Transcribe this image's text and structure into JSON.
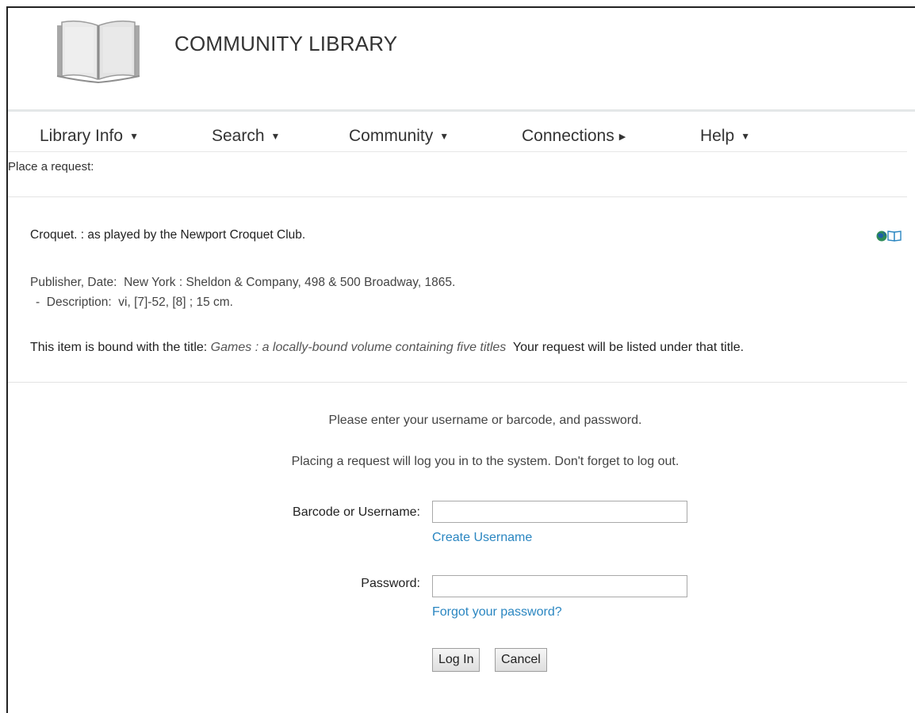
{
  "header": {
    "brand": "COMMUNITY LIBRARY",
    "logo_icon": "open-book-icon"
  },
  "nav": {
    "items": [
      {
        "label": "Library Info",
        "indicator": "caret-down"
      },
      {
        "label": "Search",
        "indicator": "caret-down"
      },
      {
        "label": "Community",
        "indicator": "caret-down"
      },
      {
        "label": "Connections",
        "indicator": "caret-right"
      },
      {
        "label": "Help",
        "indicator": "caret-down"
      }
    ]
  },
  "page": {
    "heading": "Place a request:"
  },
  "item": {
    "title": "Croquet. : as played by the Newport Croquet Club.",
    "icons": [
      "globe-icon",
      "book-icon"
    ],
    "publisher_label": "Publisher, Date:",
    "publisher_value": "New York : Sheldon & Company, 498 & 500 Broadway, 1865.",
    "description_bullet": "-",
    "description_label": "Description:",
    "description_value": "vi, [7]-52, [8] ; 15 cm.",
    "bound_prefix": "This item is bound with the title:",
    "bound_title": "Games : a locally-bound volume containing five titles",
    "bound_suffix": "Your request will be listed under that title."
  },
  "login": {
    "instruction1": "Please enter your username or barcode, and password.",
    "instruction2": "Placing a request will log you in to the system. Don't forget to log out.",
    "username_label": "Barcode or Username:",
    "username_value": "",
    "create_link": "Create Username",
    "password_label": "Password:",
    "password_value": "",
    "forgot_link": "Forgot your password?",
    "login_button": "Log In",
    "cancel_button": "Cancel"
  },
  "colors": {
    "link": "#2a86c1",
    "text": "#333333",
    "divider": "#e3e3e3"
  }
}
